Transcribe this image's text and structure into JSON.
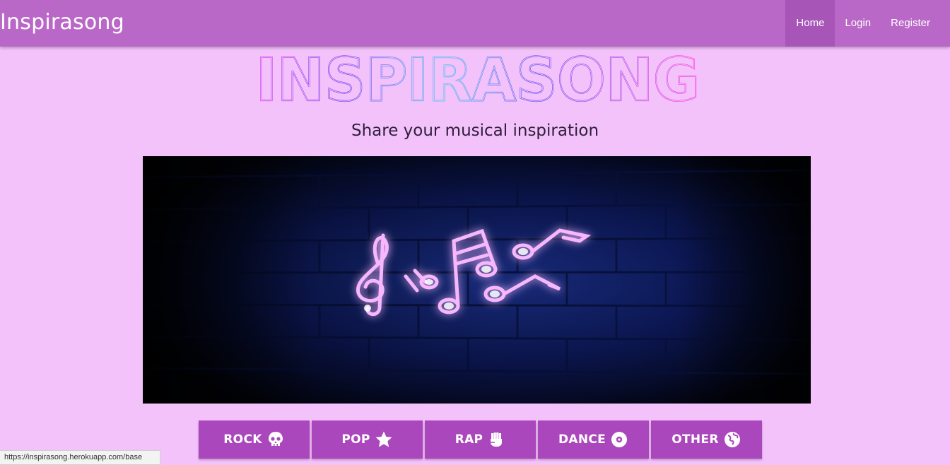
{
  "navbar": {
    "brand": "Inspirasong",
    "links": [
      {
        "label": "Home",
        "active": true
      },
      {
        "label": "Login",
        "active": false
      },
      {
        "label": "Register",
        "active": false
      }
    ],
    "color": "#ba68c8"
  },
  "logo": {
    "text": "INSPIRASONG"
  },
  "tagline": "Share your musical inspiration",
  "hero": {
    "subject": "neon music notes on brick wall"
  },
  "genres": [
    {
      "label": "ROCK",
      "icon": "skull-icon"
    },
    {
      "label": "POP",
      "icon": "star-icon"
    },
    {
      "label": "RAP",
      "icon": "fist-icon"
    },
    {
      "label": "DANCE",
      "icon": "disc-icon"
    },
    {
      "label": "OTHER",
      "icon": "globe-icon"
    }
  ],
  "status_url": "https://inspirasong.herokuapp.com/base",
  "colors": {
    "page_bg": "#f4c2fb",
    "button_bg": "#ab47bc"
  }
}
